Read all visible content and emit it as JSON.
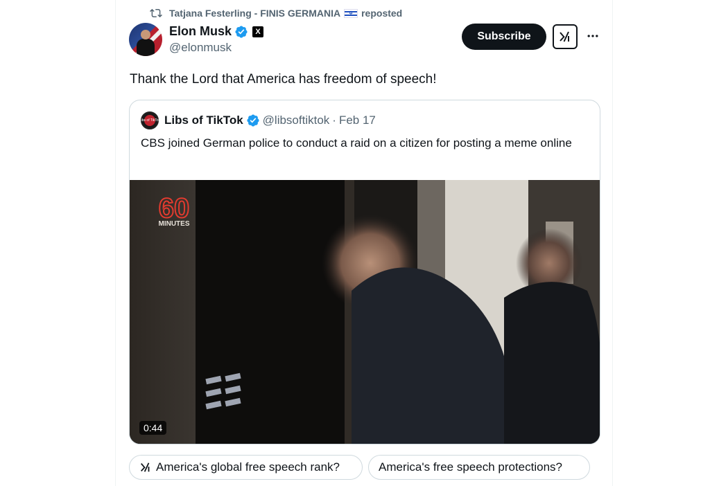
{
  "repost": {
    "text": "Tatjana Festerling - FINIS GERMANIA",
    "suffix": "reposted",
    "icon": "repost-icon",
    "flag_icon": "israel-flag-icon"
  },
  "author": {
    "name": "Elon Musk",
    "handle": "@elonmusk",
    "verified_icon": "verified-badge-icon",
    "affiliate_badge": "X"
  },
  "actions": {
    "subscribe_label": "Subscribe",
    "grok_icon": "grok-icon",
    "more_icon": "more-icon"
  },
  "tweet": {
    "text": "Thank the Lord that America has freedom of speech!"
  },
  "quote": {
    "name": "Libs of TikTok",
    "handle": "@libsoftiktok",
    "separator": "·",
    "date": "Feb 17",
    "text": "CBS joined German police to conduct a raid on a citizen for posting a meme online",
    "avatar_text": "Libs of TikTok",
    "media": {
      "duration": "0:44",
      "logo_number": "60",
      "logo_word": "MINUTES"
    }
  },
  "suggestions": [
    {
      "label": "America's global free speech rank?",
      "icon": "grok-icon"
    },
    {
      "label": "America's free speech protections?"
    }
  ],
  "colors": {
    "text_primary": "#0f1419",
    "text_secondary": "#536471",
    "verified_blue": "#1d9bf0",
    "border": "#cfd9de"
  }
}
